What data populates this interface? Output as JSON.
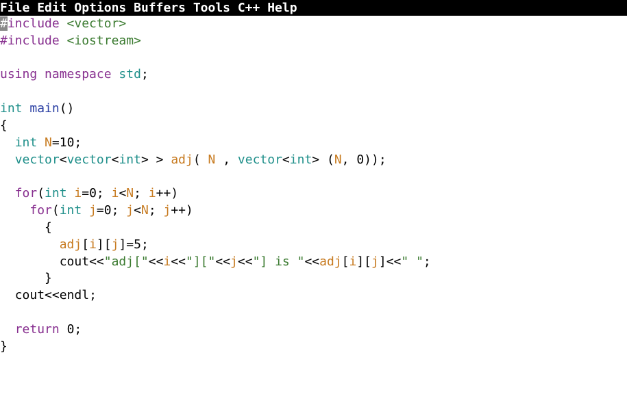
{
  "menubar": {
    "items": [
      "File",
      "Edit",
      "Options",
      "Buffers",
      "Tools",
      "C++",
      "Help"
    ]
  },
  "code": {
    "l1": {
      "hash": "#",
      "include": "include",
      "hdr": "<vector>"
    },
    "l2": {
      "hash": "#",
      "include": "include",
      "hdr": "<iostream>"
    },
    "l3": {
      "blank": ""
    },
    "l4": {
      "using": "using",
      "namespace": "namespace",
      "std": "std",
      "semi": ";"
    },
    "l5": {
      "blank": ""
    },
    "l6": {
      "int": "int",
      "main": "main",
      "parens": "()"
    },
    "l7": {
      "brace": "{"
    },
    "l8": {
      "indent": "  ",
      "int": "int",
      "sp": " ",
      "N": "N",
      "rest": "=10;"
    },
    "l9": {
      "indent": "  ",
      "vector1": "vector",
      "lt1": "<",
      "vector2": "vector",
      "lt2": "<",
      "int": "int",
      "gt1": ">",
      "sp1": " ",
      "gt2": ">",
      "sp2": " ",
      "adj": "adj",
      "open": "( ",
      "N1": "N",
      "mid": " , ",
      "vector3": "vector",
      "lt3": "<",
      "int2": "int",
      "gt3": ">",
      "sp3": " (",
      "N2": "N",
      "rest": ", 0));"
    },
    "l10": {
      "blank": ""
    },
    "l11": {
      "indent": "  ",
      "for": "for",
      "open": "(",
      "int": "int",
      "sp": " ",
      "i": "i",
      "eq": "=0; ",
      "i2": "i",
      "lt": "<",
      "N": "N",
      "semi": "; ",
      "i3": "i",
      "inc": "++)"
    },
    "l12": {
      "indent": "    ",
      "for": "for",
      "open": "(",
      "int": "int",
      "sp": " ",
      "j": "j",
      "eq": "=0; ",
      "j2": "j",
      "lt": "<",
      "N": "N",
      "semi": "; ",
      "j3": "j",
      "inc": "++)"
    },
    "l13": {
      "indent": "      ",
      "brace": "{"
    },
    "l14": {
      "indent": "        ",
      "adj": "adj",
      "b1": "[",
      "i": "i",
      "b2": "][",
      "j": "j",
      "b3": "]=5;"
    },
    "l15": {
      "indent": "        ",
      "cout": "cout",
      "op1": "<<",
      "s1": "\"adj[\"",
      "op2": "<<",
      "i": "i",
      "op3": "<<",
      "s2": "\"][\"",
      "op4": "<<",
      "j": "j",
      "op5": "<<",
      "s3": "\"] is \"",
      "op6": "<<",
      "adj": "adj",
      "b1": "[",
      "i2": "i",
      "b2": "][",
      "j2": "j",
      "b3": "]",
      "op7": "<<",
      "s4": "\" \"",
      "semi": ";"
    },
    "l16": {
      "indent": "      ",
      "brace": "}"
    },
    "l17": {
      "indent": "  ",
      "cout": "cout",
      "op": "<<",
      "endl": "endl",
      "semi": ";"
    },
    "l18": {
      "blank": ""
    },
    "l19": {
      "indent": "  ",
      "return": "return",
      "sp": " ",
      "zero": "0",
      "semi": ";"
    },
    "l20": {
      "brace": "}"
    }
  }
}
